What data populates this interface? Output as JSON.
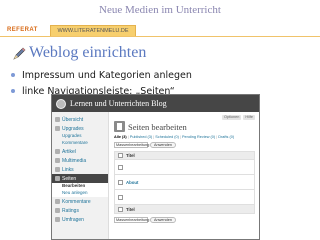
{
  "slide": {
    "title": "Neue Medien im Unterricht",
    "tag": "REFERAT",
    "url": "WWW.LITERATENMELU.DE",
    "heading": "Weblog einrichten",
    "bullets": [
      "Impressum und Kategorien anlegen",
      "linke Navigationsleiste: „Seiten“"
    ],
    "colors": {
      "title": "#8a86b0",
      "heading": "#5b79c0",
      "tag": "#d86a16",
      "url_tab": "#f7cf6e",
      "bullet": "#7e9ad6"
    }
  },
  "wordpress": {
    "blog_name": "Lernen und Unterrichten Blog",
    "help_buttons": [
      "Optionen",
      "Hilfe"
    ],
    "sidebar": {
      "items": [
        {
          "label": "Übersicht",
          "icon": "dashboard-icon"
        },
        {
          "label": "Upgrades",
          "icon": "upgrade-icon"
        },
        {
          "label": "Upgrades",
          "submenu": true
        },
        {
          "label": "Kommentare",
          "submenu": true
        },
        {
          "label": "Artikel",
          "icon": "pin-icon"
        },
        {
          "label": "Multimedia",
          "icon": "media-icon"
        },
        {
          "label": "Links",
          "icon": "link-icon"
        },
        {
          "label": "Seiten",
          "icon": "pages-icon",
          "active": true
        },
        {
          "label": "Bearbeiten",
          "submenu": true,
          "current": true
        },
        {
          "label": "Neu anlegen",
          "submenu": true
        },
        {
          "label": "Kommentare",
          "icon": "comments-icon"
        },
        {
          "label": "Ratings",
          "icon": "ratings-icon"
        },
        {
          "label": "Umfragen",
          "icon": "polls-icon"
        }
      ]
    },
    "page_title": "Seiten bearbeiten",
    "filters": [
      {
        "label": "Alle (3)",
        "current": true
      },
      {
        "label": "Published (3)"
      },
      {
        "label": "Scheduled (0)"
      },
      {
        "label": "Pending Review (0)"
      },
      {
        "label": "Drafts (0)"
      }
    ],
    "bulk_action_select": "Massenbearbeitung",
    "apply_button": "Anwenden",
    "table": {
      "column_header": "Titel",
      "rows": [
        "",
        "About",
        ""
      ],
      "footer_header": "Titel"
    }
  }
}
